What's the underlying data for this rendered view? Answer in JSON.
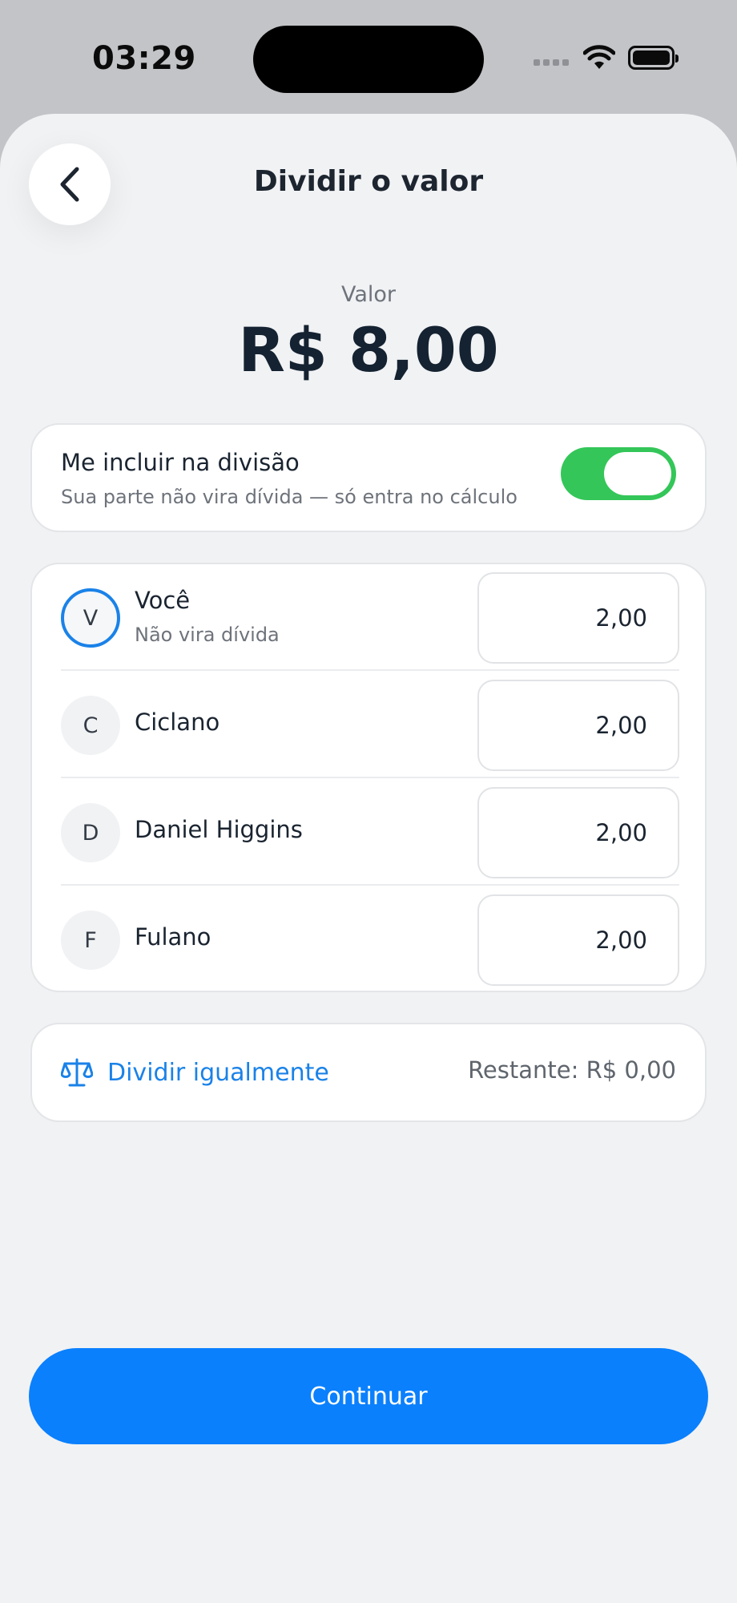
{
  "status_bar": {
    "time": "03:29"
  },
  "header": {
    "title": "Dividir o valor"
  },
  "amount": {
    "label": "Valor",
    "value": "R$ 8,00"
  },
  "include": {
    "title": "Me incluir na divisão",
    "subtitle": "Sua parte não vira dívida — só entra no cálculo",
    "enabled": true
  },
  "people": [
    {
      "initial": "V",
      "name": "Você",
      "subtitle": "Não vira dívida",
      "amount": "2,00"
    },
    {
      "initial": "C",
      "name": "Ciclano",
      "amount": "2,00"
    },
    {
      "initial": "D",
      "name": "Daniel Higgins",
      "amount": "2,00"
    },
    {
      "initial": "F",
      "name": "Fulano",
      "amount": "2,00"
    }
  ],
  "split": {
    "label": "Dividir igualmente",
    "remaining": "Restante: R$ 0,00"
  },
  "continue_label": "Continuar",
  "colors": {
    "accent": "#0a80fd",
    "toggle_on": "#34c659",
    "link": "#1a82e8"
  }
}
